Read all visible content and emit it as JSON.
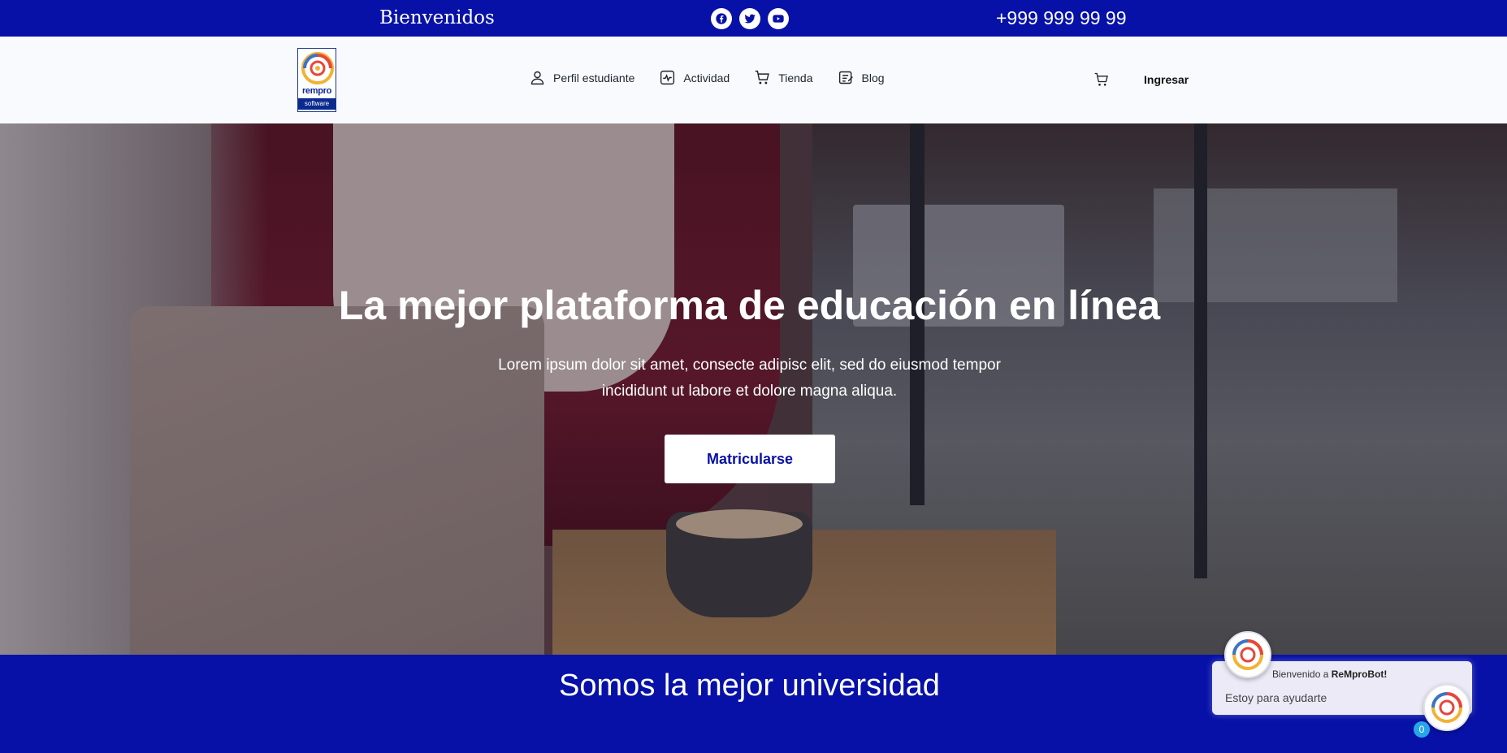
{
  "topbar": {
    "welcome": "Bienvenidos",
    "phone": "+999 999 99 99",
    "socials": [
      "facebook-icon",
      "twitter-icon",
      "youtube-icon"
    ]
  },
  "header": {
    "logo_text": "rempro",
    "logo_subtext": "software",
    "nav": [
      {
        "label": "Perfil estudiante",
        "icon": "user-icon"
      },
      {
        "label": "Actividad",
        "icon": "activity-icon"
      },
      {
        "label": "Tienda",
        "icon": "cart-icon"
      },
      {
        "label": "Blog",
        "icon": "blog-icon"
      }
    ],
    "cart_icon": "cart-icon",
    "login_label": "Ingresar"
  },
  "hero": {
    "title": "La mejor plataforma de educación en línea",
    "subtitle": "Lorem ipsum dolor sit amet, consecte adipisc elit, sed do eiusmod tempor incididunt ut labore et dolore magna aliqua.",
    "cta_label": "Matricularse"
  },
  "band": {
    "title": "Somos la mejor universidad"
  },
  "chat": {
    "welcome_prefix": "Bienvenido a ",
    "bot_name": "ReMproBot!",
    "message": "Estoy para ayudarte",
    "badge_count": "0"
  },
  "colors": {
    "primary": "#0711a8",
    "header_bg": "#f8fafd",
    "badge": "#27a6e6"
  }
}
